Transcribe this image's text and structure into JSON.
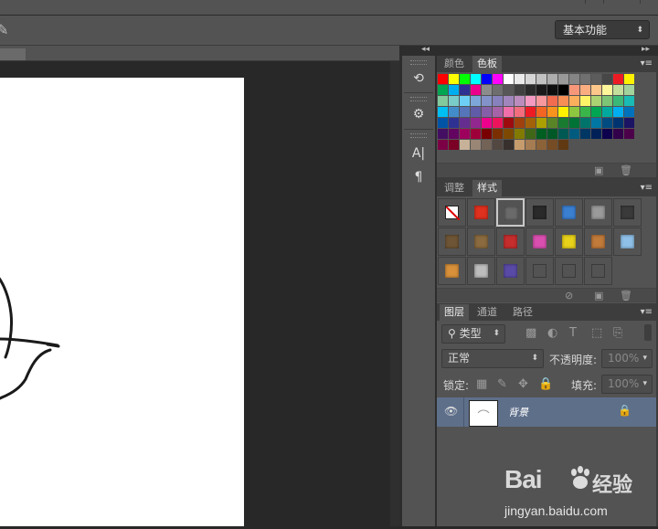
{
  "options_bar": {
    "workspace_label": "基本功能",
    "workspace_options": [
      "基本功能"
    ]
  },
  "icon_strip": {
    "buttons": [
      {
        "name": "history-icon",
        "glyph": "⟲"
      },
      {
        "name": "properties-icon",
        "glyph": "⚙"
      },
      {
        "name": "character-icon",
        "glyph": "A|"
      },
      {
        "name": "paragraph-icon",
        "glyph": "¶"
      }
    ]
  },
  "color_panel": {
    "tabs": [
      "颜色",
      "色板"
    ],
    "active_tab": "色板",
    "swatch_rows": [
      [
        "#ff0000",
        "#ffff00",
        "#00ff00",
        "#00ffff",
        "#0000ff",
        "#ff00ff",
        "#ffffff",
        "#ebebeb",
        "#d6d6d6",
        "#c2c2c2",
        "#adadad",
        "#999999",
        "#858585",
        "#707070",
        "#5c5c5c",
        "#474747",
        "#ed1c24",
        "#fff200"
      ],
      [
        "#00a651",
        "#00aeef",
        "#2e3192",
        "#ec008c",
        "#8c8c8c",
        "#6e6e6e",
        "#575757",
        "#404040",
        "#2b2b2b",
        "#1a1a1a",
        "#0f0f0f",
        "#000000",
        "#f7977a",
        "#f9ad81",
        "#fdc68a",
        "#fff79a",
        "#c4df9b",
        "#a3d39c"
      ],
      [
        "#82ca9c",
        "#7accc8",
        "#6dcff6",
        "#7da7d9",
        "#8393ca",
        "#8781bd",
        "#a186be",
        "#bd8cbf",
        "#f49ac2",
        "#f6989d",
        "#f26c4f",
        "#f68e55",
        "#fbaf5c",
        "#fff467",
        "#acd372",
        "#7cc576",
        "#3bb878",
        "#1abbb4"
      ],
      [
        "#00bff3",
        "#438cca",
        "#5574b9",
        "#605ca8",
        "#855fa8",
        "#a763a8",
        "#f06ea9",
        "#f26d7d",
        "#ed1c24",
        "#f26522",
        "#f7941d",
        "#fff200",
        "#8dc73f",
        "#39b54a",
        "#00a651",
        "#00a99d",
        "#00aeef",
        "#0072bc"
      ],
      [
        "#0054a6",
        "#2e3192",
        "#662d91",
        "#92278f",
        "#ec008c",
        "#ed145b",
        "#9e0b0f",
        "#a0410d",
        "#a36209",
        "#aba000",
        "#598527",
        "#197b30",
        "#007236",
        "#00746b",
        "#0076a3",
        "#004b80",
        "#003471",
        "#1b1464"
      ],
      [
        "#440e62",
        "#630460",
        "#9e005d",
        "#9e0039",
        "#790000",
        "#7b2e00",
        "#7d4900",
        "#827b00",
        "#406618",
        "#005e20",
        "#005826",
        "#005952",
        "#005b7f",
        "#003663",
        "#002157",
        "#0d004c",
        "#32004b",
        "#4b0049"
      ],
      [
        "#7b0046",
        "#7a0026",
        "#c7b299",
        "#998675",
        "#736357",
        "#534741",
        "#37302d",
        "#c69c6d",
        "#a67c52",
        "#8c6239",
        "#754c24",
        "#603913"
      ]
    ]
  },
  "styles_panel": {
    "tabs": [
      "调整",
      "样式"
    ],
    "active_tab": "样式",
    "cells": [
      {
        "name": "style-none-icon",
        "color": "#ffffff"
      },
      {
        "name": "style-red-glow-icon",
        "color": "#e0301e"
      },
      {
        "name": "style-gray-bevel-icon",
        "color": "#6a6a6a"
      },
      {
        "name": "style-black-button-icon",
        "color": "#2a2a2a"
      },
      {
        "name": "style-blue-sky-icon",
        "color": "#3b7fd1"
      },
      {
        "name": "style-light-gray-icon",
        "color": "#9a9a9a"
      },
      {
        "name": "style-dark-gradient-icon",
        "color": "#3a3a3a"
      },
      {
        "name": "style-brown-texture-icon",
        "color": "#6e5535"
      },
      {
        "name": "style-wood-icon",
        "color": "#8a6a3e"
      },
      {
        "name": "style-red-stripe-icon",
        "color": "#c62d2d"
      },
      {
        "name": "style-colorful-icon",
        "color": "#d94fb0"
      },
      {
        "name": "style-yellow-icon",
        "color": "#e8d11a"
      },
      {
        "name": "style-orange-wood-icon",
        "color": "#c07a3a"
      },
      {
        "name": "style-light-blue-icon",
        "color": "#8fc0e8"
      },
      {
        "name": "style-sunset-icon",
        "color": "#d8903a"
      },
      {
        "name": "style-pattern-icon",
        "color": "#bdbdbd"
      },
      {
        "name": "style-purple-icon",
        "color": "#5a4aa8"
      },
      {
        "name": "style-dark-square-icon",
        "color": "#4a4a4a"
      },
      {
        "name": "style-outline-square-icon",
        "color": "#555555"
      },
      {
        "name": "style-outline-square2-icon",
        "color": "#555555"
      }
    ]
  },
  "layers_panel": {
    "tabs": [
      "图层",
      "通道",
      "路径"
    ],
    "active_tab": "图层",
    "filter_label": "类型",
    "blend_mode": "正常",
    "opacity_label": "不透明度:",
    "opacity_value": "100%",
    "lock_label": "锁定:",
    "fill_label": "填充:",
    "fill_value": "100%",
    "layers": [
      {
        "name": "背景",
        "visible": true,
        "locked": true
      }
    ]
  },
  "watermark": {
    "brand": "Bai",
    "brand_cn": "经验",
    "url": "jingyan.baidu.com"
  }
}
